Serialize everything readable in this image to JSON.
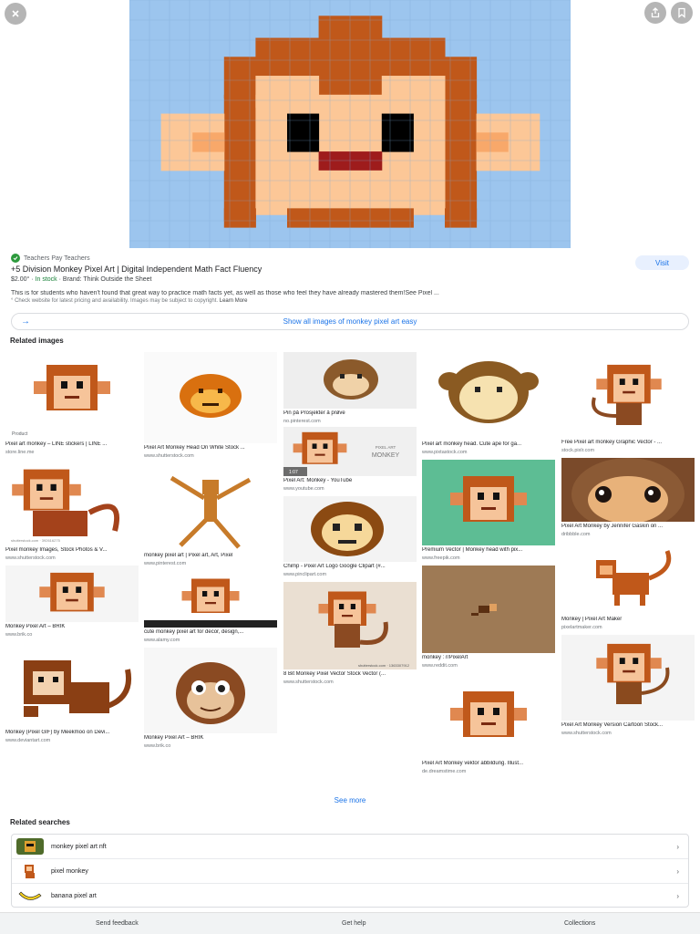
{
  "hero": {
    "close_icon": "close-icon",
    "share_icon": "share-icon",
    "bookmark_icon": "bookmark-icon"
  },
  "result": {
    "source": "Teachers Pay Teachers",
    "title": "+5 Division Monkey Pixel Art | Digital Independent Math Fact Fluency",
    "price": "$2.00°",
    "stock": "In stock",
    "brand": "Brand: Think Outside the Sheet",
    "visit_label": "Visit",
    "description": "This is for students who haven't found that great way to practice math facts yet, as well as those who feel they have already mastered them!See Pixel ...",
    "disclaimer": "° Check website for latest pricing and availability. Images may be subject to copyright.",
    "learn_more": "Learn More",
    "show_all": "Show all images of monkey pixel art easy"
  },
  "related_images": {
    "heading": "Related images",
    "product_badge": "Product",
    "items": [
      {
        "caption": "Pixel art monkey – LINE stickers | LINE ...",
        "domain": "store.line.me"
      },
      {
        "caption": "Pixel monkey Images, Stock Photos & V...",
        "domain": "www.shutterstock.com"
      },
      {
        "caption": "Monkey Pixel Art – BRIK",
        "domain": "www.brik.co"
      },
      {
        "caption": "Monkey (Pixel GIF) by Meekmoo on Devi...",
        "domain": "www.deviantart.com"
      },
      {
        "caption": "Pixel Art Monkey Head On White Stock ...",
        "domain": "www.shutterstock.com"
      },
      {
        "caption": "monkey pixel art | Pixel art, Art, Pixel",
        "domain": "www.pinterest.com"
      },
      {
        "caption": "cute monkey pixel art for decor, design,...",
        "domain": "www.alamy.com"
      },
      {
        "caption": "Monkey Pixel Art – BRIK",
        "domain": "www.brik.co"
      },
      {
        "caption": "Pin på Prosjekter å prøve",
        "domain": "no.pinterest.com"
      },
      {
        "caption": "Pixel Art: Monkey - YouTube",
        "domain": "www.youtube.com"
      },
      {
        "caption": "Chimp - Pixel Art Logo Google Clipart (#...",
        "domain": "www.pinclipart.com"
      },
      {
        "caption": "8 Bit Monkey Pixel Vector Stock Vector (...",
        "domain": "www.shutterstock.com"
      },
      {
        "caption": "Pixel art monkey head. Cute ape for ga...",
        "domain": "www.pixtastock.com"
      },
      {
        "caption": "Premium Vector | Monkey head with pix...",
        "domain": "www.freepik.com"
      },
      {
        "caption": "monkey : r/PixelArt",
        "domain": "www.reddit.com"
      },
      {
        "caption": "Pixel Art Monkey vektor abbildung. Illust...",
        "domain": "de.dreamstime.com"
      },
      {
        "caption": "Free Pixel art monkey Graphic Vector - ...",
        "domain": "stock.pixlr.com"
      },
      {
        "caption": "Pixel Art Monkey by Jennifer Gaskin on ...",
        "domain": "dribbble.com"
      },
      {
        "caption": "Monkey | Pixel Art Maker",
        "domain": "pixelartmaker.com"
      },
      {
        "caption": "Pixel Art Monkey Version Cartoon Stock...",
        "domain": "www.shutterstock.com"
      }
    ],
    "video_duration": "1:07",
    "pixel_art_label_1": "PIXEL ART",
    "pixel_art_label_2": "MONKEY",
    "watermark_1": "shutterstock.com · 392616275",
    "watermark_2": "shutterstock.com · 1363307912"
  },
  "see_more": "See more",
  "related_searches": {
    "heading": "Related searches",
    "items": [
      {
        "label": "monkey pixel art nft"
      },
      {
        "label": "pixel monkey"
      },
      {
        "label": "banana pixel art"
      }
    ]
  },
  "footer": {
    "send_feedback": "Send feedback",
    "get_help": "Get help",
    "collections": "Collections"
  },
  "colors": {
    "sky": "#9cc5ee",
    "fur": "#c0581a",
    "skin": "#fcc797",
    "accent": "#1a73e8"
  }
}
